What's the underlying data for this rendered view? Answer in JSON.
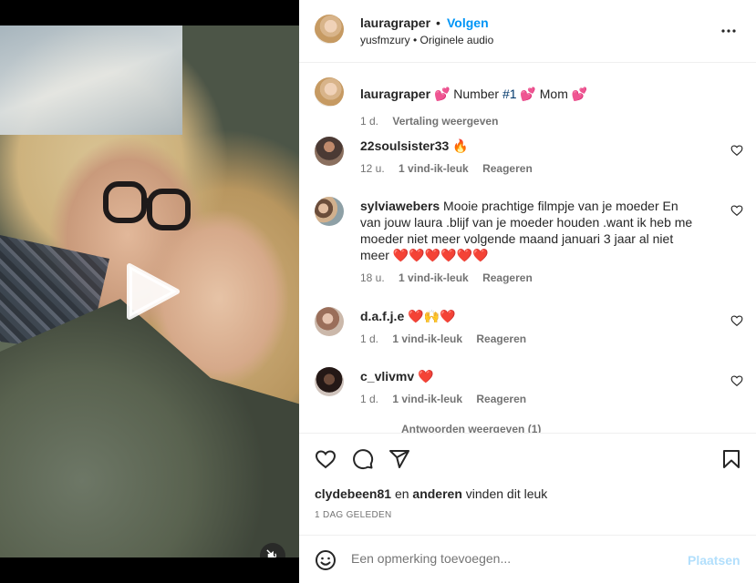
{
  "post": {
    "username": "lauragraper",
    "dot": "•",
    "follow_label": "Volgen",
    "audio_line": "yusfmzury • Originele audio",
    "caption_user": "lauragraper",
    "caption_text_a": "💕 Number ",
    "caption_hashtag": "#1",
    "caption_text_b": " 💕 Mom 💕",
    "caption_age": "1 d.",
    "caption_translate": "Vertaling weergeven"
  },
  "comments": [
    {
      "user": "22soulsister33",
      "text": " 🔥",
      "age": "12 u.",
      "likes": "1 vind-ik-leuk",
      "reply": "Reageren"
    },
    {
      "user": "sylviawebers",
      "text": " Mooie prachtige filmpje van je moeder En van jouw laura .blijf van je moeder houden .want ik heb me moeder niet meer volgende maand januari 3 jaar al niet meer ❤️❤️❤️❤️❤️❤️",
      "age": "18 u.",
      "likes": "1 vind-ik-leuk",
      "reply": "Reageren"
    },
    {
      "user": "d.a.f.j.e",
      "text": " ❤️🙌❤️",
      "age": "1 d.",
      "likes": "1 vind-ik-leuk",
      "reply": "Reageren"
    },
    {
      "user": "c_vlivmv",
      "text": " ❤️",
      "age": "1 d.",
      "likes": "1 vind-ik-leuk",
      "reply": "Reageren"
    }
  ],
  "more_replies": "Antwoorden weergeven (1)",
  "likes_line": {
    "user": "clydebeen81",
    "mid": " en ",
    "others": "anderen",
    "tail": " vinden dit leuk"
  },
  "date_label": "1 DAG GELEDEN",
  "composer": {
    "placeholder": "Een opmerking toevoegen...",
    "post_label": "Plaatsen"
  },
  "icons": {
    "play": "play-icon",
    "mute": "muted-speaker-icon",
    "more": "more-options-icon",
    "like": "heart-icon",
    "comment": "comment-bubble-icon",
    "share": "paper-plane-icon",
    "save": "bookmark-icon",
    "emoji": "emoji-smiley-icon"
  },
  "colors": {
    "accent": "#0095f6",
    "post_disabled": "#b2dffc",
    "muted_text": "#737373",
    "text": "#262626"
  }
}
